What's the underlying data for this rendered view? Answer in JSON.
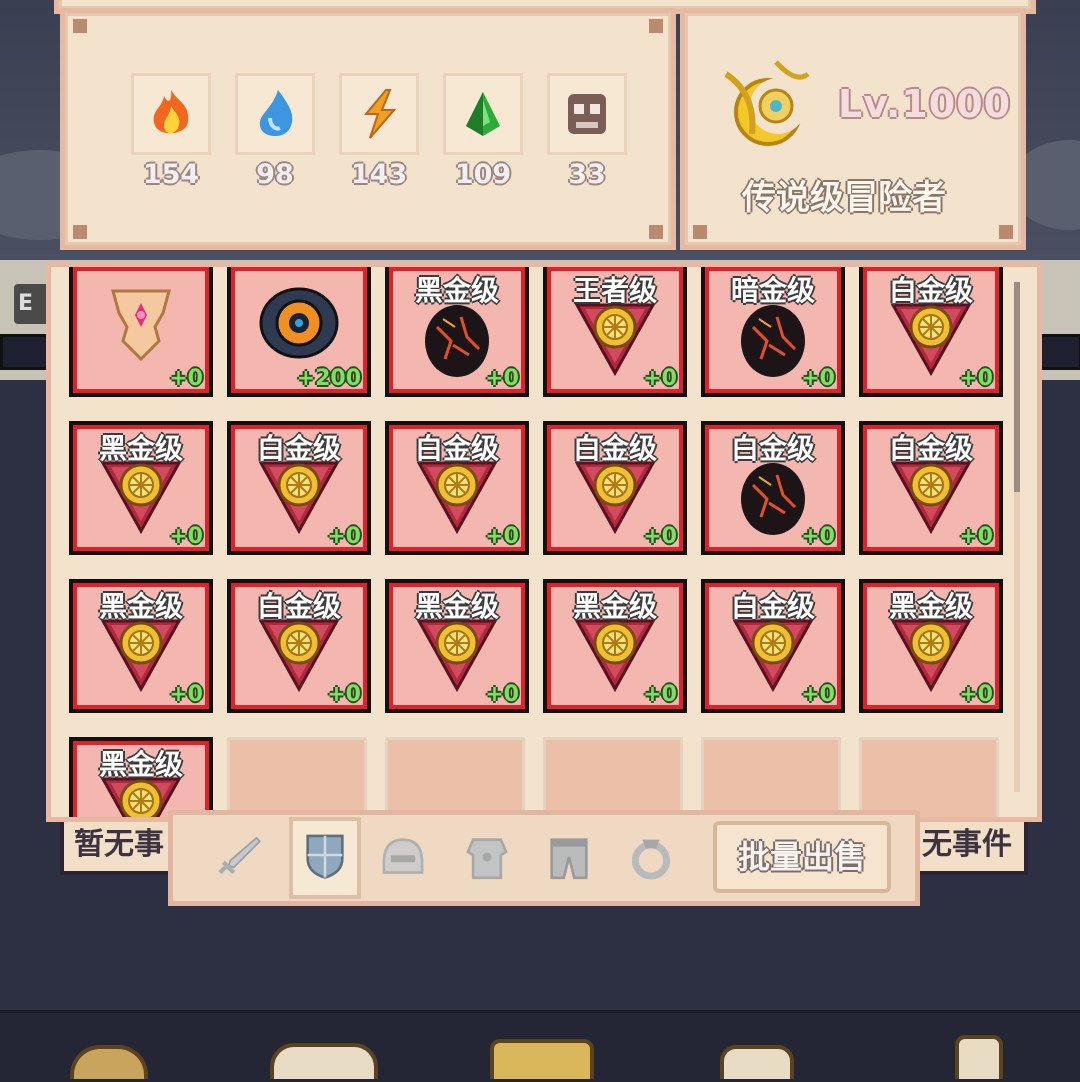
{
  "resources": [
    {
      "icon": "fire-essence-icon",
      "count": "154",
      "color": "#e8402a"
    },
    {
      "icon": "water-drop-icon",
      "count": "98",
      "color": "#3c96e0"
    },
    {
      "icon": "lightning-icon",
      "count": "143",
      "color": "#f0a020"
    },
    {
      "icon": "green-crystal-icon",
      "count": "109",
      "color": "#2eaa3a"
    },
    {
      "icon": "skull-icon",
      "count": "33",
      "color": "#7a5e56"
    }
  ],
  "player": {
    "level": "Lv.1000",
    "title": "传说级冒险者",
    "emblem_icon": "golden-moon-emblem-icon"
  },
  "inventory": {
    "rows": [
      [
        {
          "grade": "",
          "item": "gold-pink-armor-icon",
          "plus": "+0"
        },
        {
          "grade": "",
          "item": "dark-eye-shield-icon",
          "plus": "+200"
        },
        {
          "grade": "黑金级",
          "item": "black-lava-egg-icon",
          "plus": "+0"
        },
        {
          "grade": "王者级",
          "item": "triangle-gold-shield-icon",
          "plus": "+0"
        },
        {
          "grade": "暗金级",
          "item": "black-lava-egg-icon",
          "plus": "+0"
        },
        {
          "grade": "白金级",
          "item": "triangle-gold-shield-icon",
          "plus": "+0"
        }
      ],
      [
        {
          "grade": "黑金级",
          "item": "triangle-gold-shield-icon",
          "plus": "+0"
        },
        {
          "grade": "白金级",
          "item": "triangle-gold-shield-icon",
          "plus": "+0"
        },
        {
          "grade": "白金级",
          "item": "triangle-gold-shield-icon",
          "plus": "+0"
        },
        {
          "grade": "白金级",
          "item": "triangle-gold-shield-icon",
          "plus": "+0"
        },
        {
          "grade": "白金级",
          "item": "black-lava-egg-icon",
          "plus": "+0"
        },
        {
          "grade": "白金级",
          "item": "triangle-gold-shield-icon",
          "plus": "+0"
        }
      ],
      [
        {
          "grade": "黑金级",
          "item": "triangle-gold-shield-icon",
          "plus": "+0"
        },
        {
          "grade": "白金级",
          "item": "triangle-gold-shield-icon",
          "plus": "+0"
        },
        {
          "grade": "黑金级",
          "item": "triangle-gold-shield-icon",
          "plus": "+0"
        },
        {
          "grade": "黑金级",
          "item": "triangle-gold-shield-icon",
          "plus": "+0"
        },
        {
          "grade": "白金级",
          "item": "triangle-gold-shield-icon",
          "plus": "+0"
        },
        {
          "grade": "黑金级",
          "item": "triangle-gold-shield-icon",
          "plus": "+0"
        }
      ],
      [
        {
          "grade": "黑金级",
          "item": "triangle-gold-shield-icon",
          "plus": ""
        },
        null,
        null,
        null,
        null,
        null
      ]
    ]
  },
  "tabs": [
    {
      "name": "tab-weapon",
      "icon": "sword-icon",
      "active": false
    },
    {
      "name": "tab-shield",
      "icon": "shield-icon",
      "active": true
    },
    {
      "name": "tab-helmet",
      "icon": "helmet-icon",
      "active": false
    },
    {
      "name": "tab-armor",
      "icon": "armor-icon",
      "active": false
    },
    {
      "name": "tab-pants",
      "icon": "pants-icon",
      "active": false
    },
    {
      "name": "tab-ring",
      "icon": "ring-icon",
      "active": false
    }
  ],
  "sell_button": "批量出售",
  "side_events": {
    "left": "暂无事",
    "right": "无事件"
  },
  "exp_label": "E"
}
